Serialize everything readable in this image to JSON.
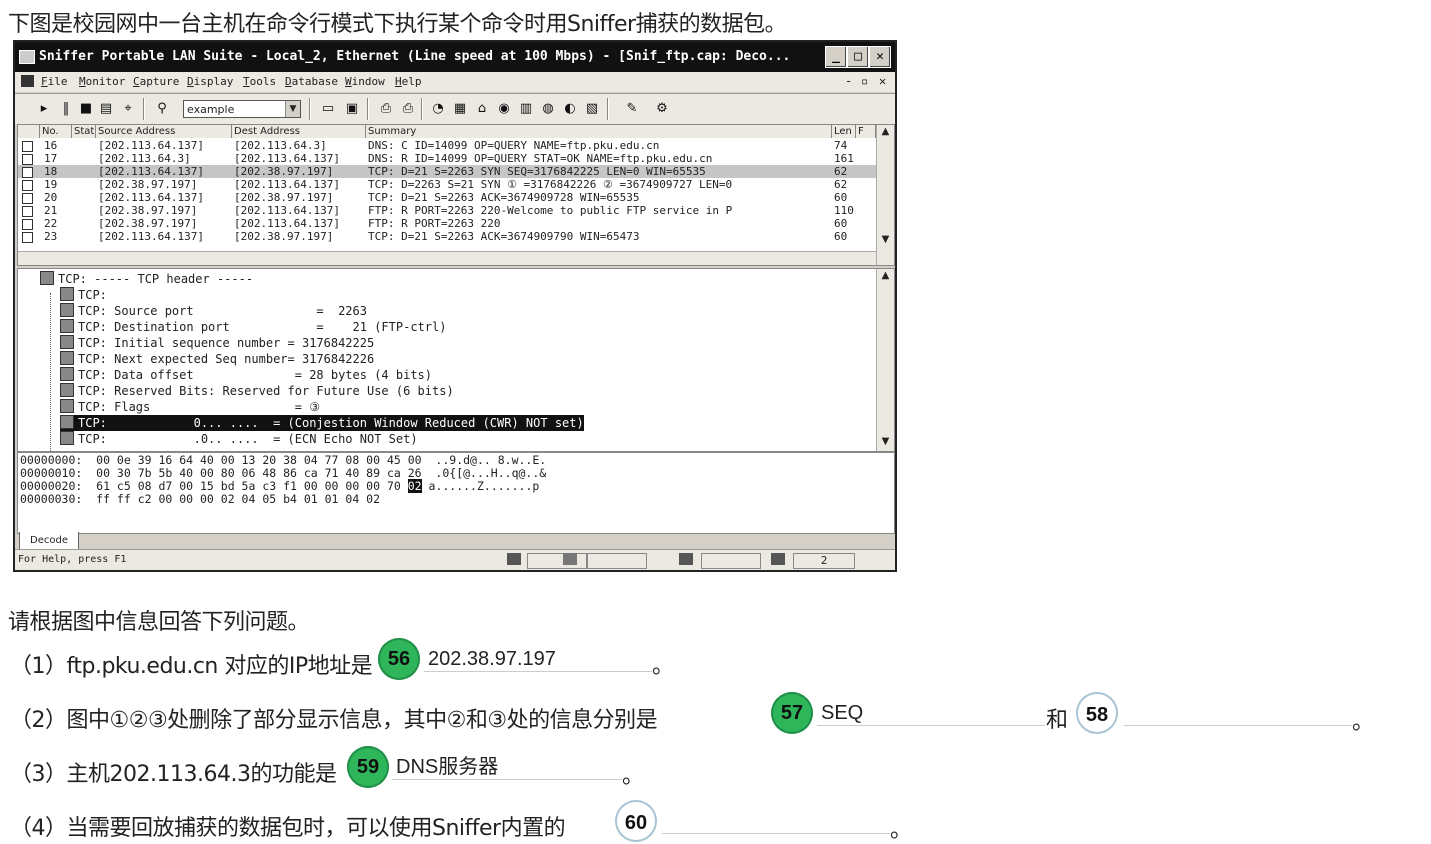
{
  "intro": "下图是校园网中一台主机在命令行模式下执行某个命令时用Sniffer捕获的数据包。",
  "window": {
    "title": "Sniffer Portable LAN Suite - Local_2, Ethernet (Line speed at 100 Mbps) - [Snif_ftp.cap: Deco...",
    "menu": [
      "File",
      "Monitor",
      "Capture",
      "Display",
      "Tools",
      "Database",
      "Window",
      "Help"
    ],
    "filter_value": "example",
    "columns": [
      "No.",
      "Stat",
      "Source Address",
      "Dest Address",
      "Summary",
      "Len (B)",
      "F"
    ],
    "packets": [
      {
        "no": "16",
        "src": "[202.113.64.137]",
        "dst": "[202.113.64.3]",
        "summary": "DNS: C ID=14099 OP=QUERY NAME=ftp.pku.edu.cn",
        "len": "74"
      },
      {
        "no": "17",
        "src": "[202.113.64.3]",
        "dst": "[202.113.64.137]",
        "summary": "DNS: R ID=14099 OP=QUERY STAT=OK NAME=ftp.pku.edu.cn",
        "len": "161"
      },
      {
        "no": "18",
        "src": "[202.113.64.137]",
        "dst": "[202.38.97.197]",
        "summary": "TCP: D=21 S=2263 SYN SEQ=3176842225 LEN=0 WIN=65535",
        "len": "62"
      },
      {
        "no": "19",
        "src": "[202.38.97.197]",
        "dst": "[202.113.64.137]",
        "summary": "TCP: D=2263 S=21 SYN ① =3176842226 ② =3674909727 LEN=0",
        "len": "62"
      },
      {
        "no": "20",
        "src": "[202.113.64.137]",
        "dst": "[202.38.97.197]",
        "summary": "TCP: D=21 S=2263      ACK=3674909728 WIN=65535",
        "len": "60"
      },
      {
        "no": "21",
        "src": "[202.38.97.197]",
        "dst": "[202.113.64.137]",
        "summary": "FTP: R PORT=2263   220-Welcome to public FTP service in P",
        "len": "110"
      },
      {
        "no": "22",
        "src": "[202.38.97.197]",
        "dst": "[202.113.64.137]",
        "summary": "FTP: R PORT=2263   220",
        "len": "60"
      },
      {
        "no": "23",
        "src": "[202.113.64.137]",
        "dst": "[202.38.97.197]",
        "summary": "TCP: D=21 S=2263      ACK=3674909790 WIN=65473",
        "len": "60"
      }
    ],
    "decode": [
      "TCP: ----- TCP header -----",
      "TCP:",
      "TCP: Source port                 =  2263",
      "TCP: Destination port            =    21 (FTP-ctrl)",
      "TCP: Initial sequence number = 3176842225",
      "TCP: Next expected Seq number= 3176842226",
      "TCP: Data offset              = 28 bytes (4 bits)",
      "TCP: Reserved Bits: Reserved for Future Use (6 bits)",
      "TCP: Flags                    = ③",
      "TCP:            0... ....  = (Conjestion Window Reduced (CWR) NOT set)",
      "TCP:            .0.. ....  = (ECN Echo NOT Set)"
    ],
    "hex": [
      {
        "pre": "00000000:  00 0e 39 16 64 40 00 13 20 38 04 77 08 00 45 00  ",
        "sel": "",
        "post": "..9.d@.. 8.w..E."
      },
      {
        "pre": "00000010:  00 30 7b 5b 40 00 80 06 48 86 ca 71 40 89 ca 26  ",
        "sel": "",
        "post": ".0{[@...H..q@..&"
      },
      {
        "pre": "00000020:  61 c5 08 d7 00 15 bd 5a c3 f1 00 00 00 00 70 ",
        "sel": "02",
        "post": " a......Z.......p"
      },
      {
        "pre": "00000030:  ff ff c2 00 00 00 02 04 05 b4 01 01 04 02",
        "sel": "",
        "post": ""
      }
    ],
    "decode_tab": "Decode",
    "status": "For Help, press F1",
    "status_count": "2"
  },
  "questions_header": "请根据图中信息回答下列问题。",
  "questions": [
    {
      "prefix": "（1）ftp.pku.edu.cn 对应的IP地址是",
      "num": "56",
      "answer": "202.38.97.197",
      "end": "。"
    },
    {
      "prefix": "（2）图中①②③处删除了部分显示信息，其中②和③处的信息分别是",
      "num": "57",
      "answer": "SEQ",
      "mid": "和",
      "num2": "58",
      "answer2": "",
      "end": "。"
    },
    {
      "prefix": "（3）主机202.113.64.3的功能是",
      "num": "59",
      "answer": "DNS服务器",
      "end": "。"
    },
    {
      "prefix": "（4）当需要回放捕获的数据包时，可以使用Sniffer内置的",
      "num": "60",
      "answer": "",
      "end": "。"
    }
  ],
  "colors": {
    "badge_answered": "#2fb65a",
    "badge_empty_border": "#a9c4d2",
    "selected_row": "#c6c6c6"
  }
}
